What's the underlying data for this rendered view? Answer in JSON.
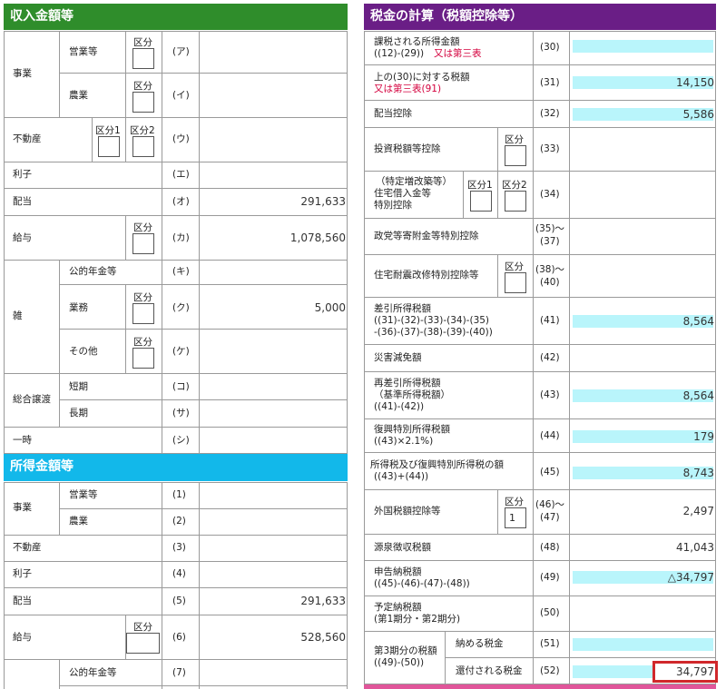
{
  "colors": {
    "header_green": "#2f8d2b",
    "header_purple": "#6a1e86",
    "header_cyan": "#12b8ea",
    "highlight_cyan": "#b9f5fb",
    "grid_line": "#9a9a9a",
    "emphasis_red": "#d4003d"
  },
  "income": {
    "title": "収入金額等",
    "kubun": "区分",
    "kubun1": "区分1",
    "kubun2": "区分2",
    "jigyo": "事業",
    "eigyo": "営業等",
    "nogyo": "農業",
    "fudosan": "不動産",
    "rishi": "利子",
    "haito": "配当",
    "kyuyo": "給与",
    "zatsu": "雑",
    "koteki": "公的年金等",
    "gyomu": "業務",
    "sonota": "その他",
    "sogo_joto": "総合譲渡",
    "tanki": "短期",
    "choki": "長期",
    "ichiji": "一時",
    "codes": [
      "(ア)",
      "(イ)",
      "(ウ)",
      "(エ)",
      "(オ)",
      "(カ)",
      "(キ)",
      "(ク)",
      "(ケ)",
      "(コ)",
      "(サ)",
      "(シ)"
    ],
    "haito_value": "291,633",
    "kyuyo_value": "1,078,560",
    "gyomu_value": "5,000"
  },
  "shotoku": {
    "title": "所得金額等",
    "codes": [
      "(1)",
      "(2)",
      "(3)",
      "(4)",
      "(5)",
      "(6)",
      "(7)"
    ],
    "haito_value": "291,633",
    "kyuyo_value": "528,560"
  },
  "tax": {
    "title": "税金の計算（税額控除等）",
    "kubun": "区分",
    "kubun1": "区分1",
    "kubun2": "区分2",
    "r30a": "課税される所得金額",
    "r30b": "((12)-(29))",
    "r30c": "又は第三表",
    "r31a": "上の(30)に対する税額",
    "r31b": "又は第三表(91)",
    "r32": "配当控除",
    "r33": "投資税額等控除",
    "r34a": "（特定増改築等）",
    "r34b": "住宅借入金等",
    "r34c": "特別控除",
    "r35": "政党等寄附金等特別控除",
    "r38": "住宅耐震改修特別控除等",
    "r41a": "差引所得税額",
    "r41b": "((31)-(32)-(33)-(34)-(35)",
    "r41c": "-(36)-(37)-(38)-(39)-(40))",
    "r42": "災害減免額",
    "r43a": "再差引所得税額",
    "r43b": "（基準所得税額）",
    "r43c": "((41)-(42))",
    "r44a": "復興特別所得税額",
    "r44b": "((43)×2.1%)",
    "r45a": "所得税及び復興特別所得税の額",
    "r45b": "((43)+(44))",
    "r46": "外国税額控除等",
    "r46_kubun_value": "1",
    "r48": "源泉徴収税額",
    "r49a": "申告納税額",
    "r49b": "((45)-(46)-(47)-(48))",
    "r50a": "予定納税額",
    "r50b": "(第1期分・第2期分)",
    "r51_group_a": "第3期分の税額",
    "r51_group_b": "((49)-(50))",
    "r51": "納める税金",
    "r52": "還付される税金",
    "codes": {
      "c30": "(30)",
      "c31": "(31)",
      "c32": "(32)",
      "c33": "(33)",
      "c34": "(34)",
      "c35a": "(35)～",
      "c35b": "(37)",
      "c38a": "(38)～",
      "c38b": "(40)",
      "c41": "(41)",
      "c42": "(42)",
      "c43": "(43)",
      "c44": "(44)",
      "c45": "(45)",
      "c46a": "(46)～",
      "c46b": "(47)",
      "c48": "(48)",
      "c49": "(49)",
      "c50": "(50)",
      "c51": "(51)",
      "c52": "(52)"
    },
    "values": {
      "v31": "14,150",
      "v32": "5,586",
      "v41": "8,564",
      "v43": "8,564",
      "v44": "179",
      "v45": "8,743",
      "v46": "2,497",
      "v48": "41,043",
      "v49": "△34,797",
      "v52": "34,797"
    }
  }
}
